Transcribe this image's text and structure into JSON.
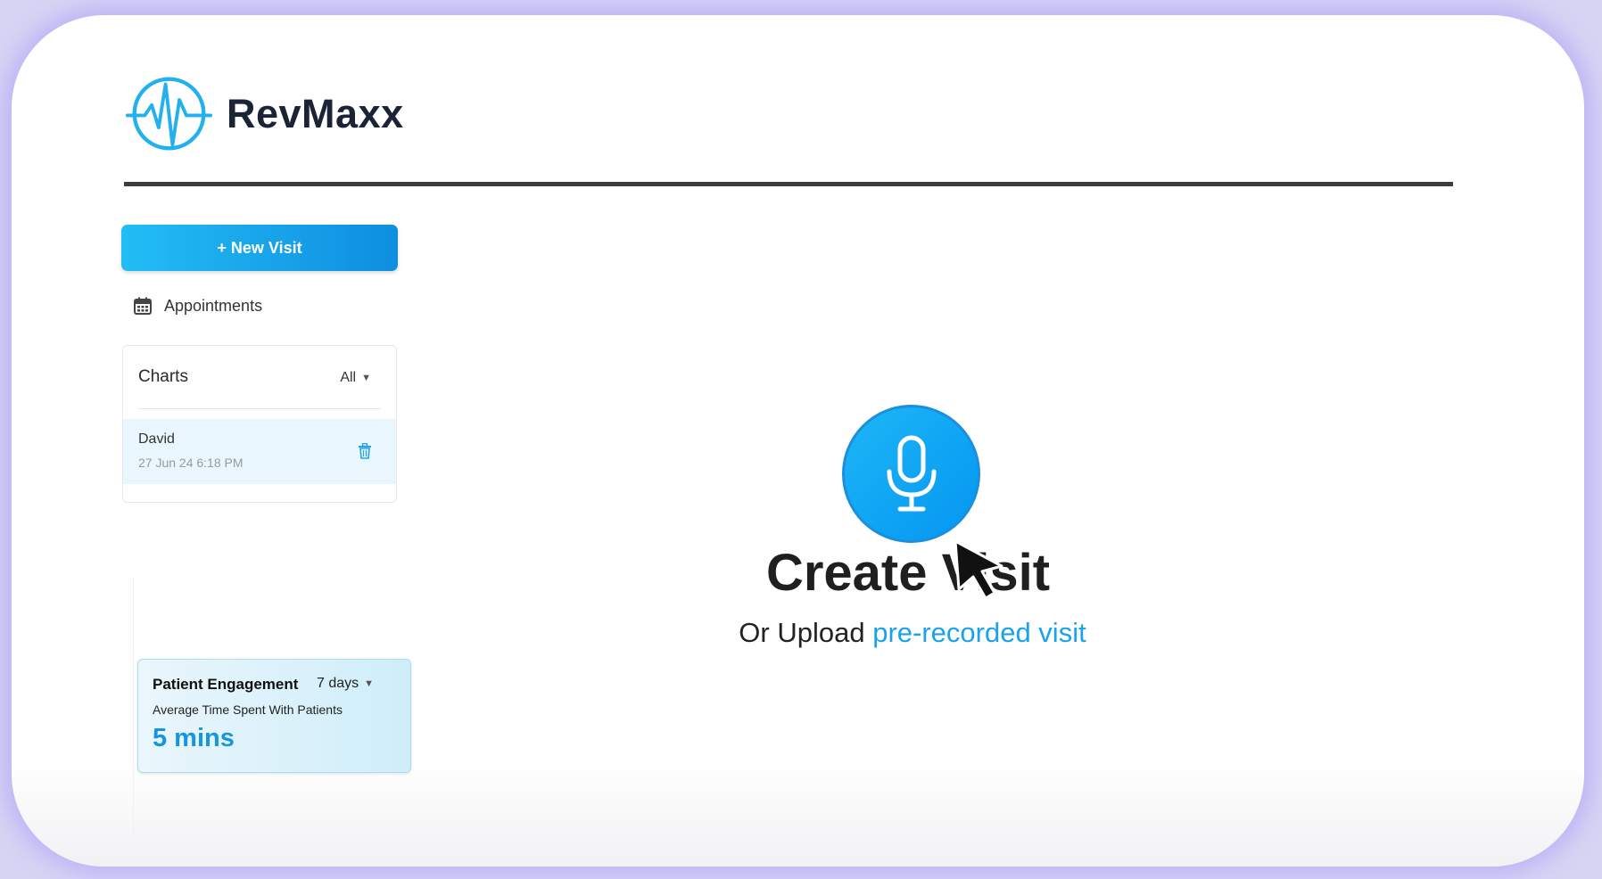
{
  "brand": {
    "name": "RevMaxx",
    "icon": "heartbeat-logo-icon"
  },
  "sidebar": {
    "new_visit_label": "+ New Visit",
    "appointments_label": "Appointments",
    "appointments_icon": "calendar-icon",
    "charts": {
      "title": "Charts",
      "filter_value": "All",
      "items": [
        {
          "name": "David",
          "date": "27 Jun 24 6:18 PM",
          "action_icon": "trash-icon"
        }
      ]
    },
    "engagement": {
      "title": "Patient Engagement",
      "range": "7 days",
      "metric_label": "Average Time Spent With Patients",
      "metric_value": "5 mins"
    }
  },
  "main": {
    "mic_icon": "microphone-icon",
    "heading": "Create Visit",
    "upload_prefix": "Or Upload",
    "upload_link": "pre-recorded visit"
  },
  "colors": {
    "accent": "#1aa2ea",
    "brand_text": "#1b2336",
    "divider": "#3d3d3d"
  }
}
